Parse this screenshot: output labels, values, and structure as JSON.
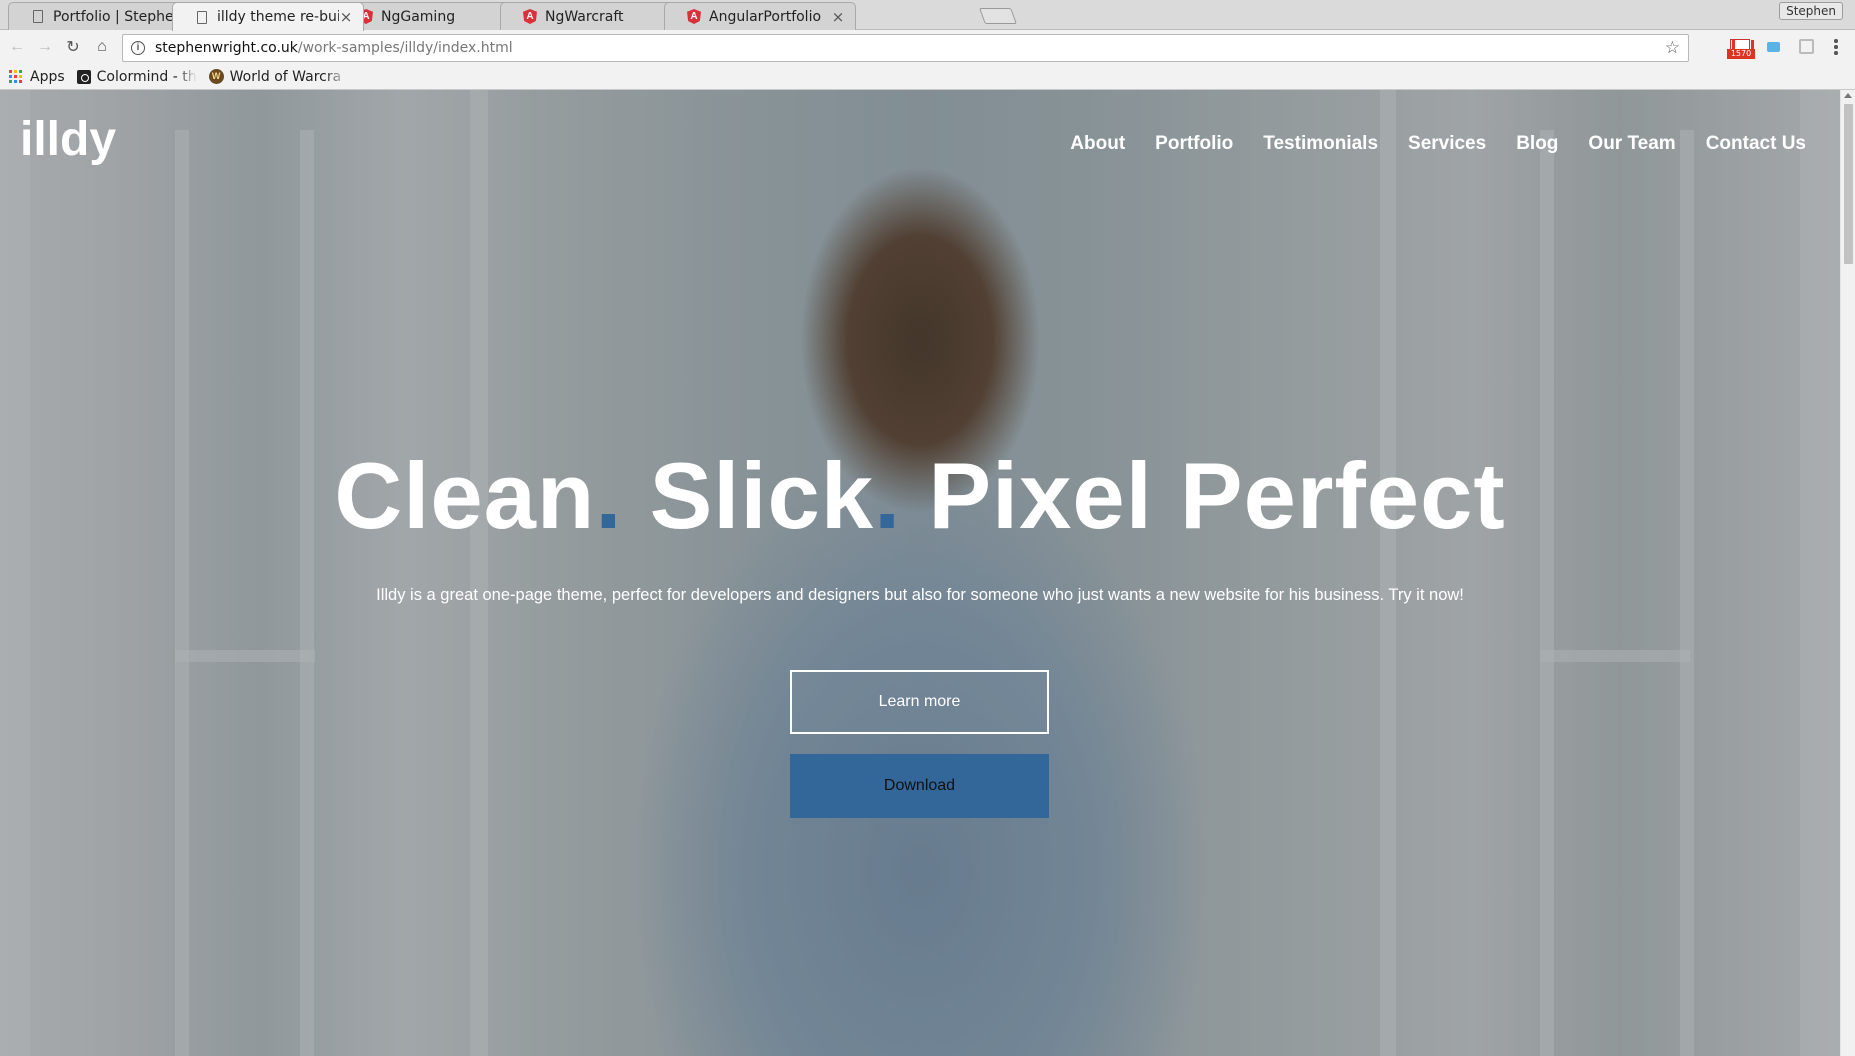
{
  "browser": {
    "tabs": [
      {
        "title": "Portfolio | Stephen",
        "icon": "document-icon"
      },
      {
        "title": "illdy theme re-built",
        "icon": "document-icon"
      },
      {
        "title": "NgGaming",
        "icon": "angular-icon"
      },
      {
        "title": "NgWarcraft",
        "icon": "angular-icon"
      },
      {
        "title": "AngularPortfolio",
        "icon": "angular-icon"
      }
    ],
    "active_tab": 1,
    "tab_close_glyph": "×",
    "profile_name": "Stephen",
    "url_host": "stephenwright.co.uk",
    "url_path": "/work-samples/illdy/index.html",
    "gmail_badge": "1570",
    "bookmarks": [
      {
        "label": "Apps",
        "icon": "apps-icon"
      },
      {
        "label": "Colormind - the s",
        "icon": "colormind-icon"
      },
      {
        "label": "World of Warcra",
        "icon": "wow-icon"
      }
    ]
  },
  "site": {
    "logo": "illdy",
    "nav": [
      "About",
      "Portfolio",
      "Testimonials",
      "Services",
      "Blog",
      "Our Team",
      "Contact Us"
    ],
    "headline": {
      "part1": "Clean",
      "part2": "Slick",
      "part3": "Pixel Perfect",
      "separator": "."
    },
    "subline": "Illdy is a great one-page theme, perfect for developers and designers but also for someone who just wants a new website for his business. Try it now!",
    "buttons": {
      "learn_more": "Learn more",
      "download": "Download"
    }
  },
  "colors": {
    "accent": "#336699",
    "text_light": "#ffffff"
  }
}
